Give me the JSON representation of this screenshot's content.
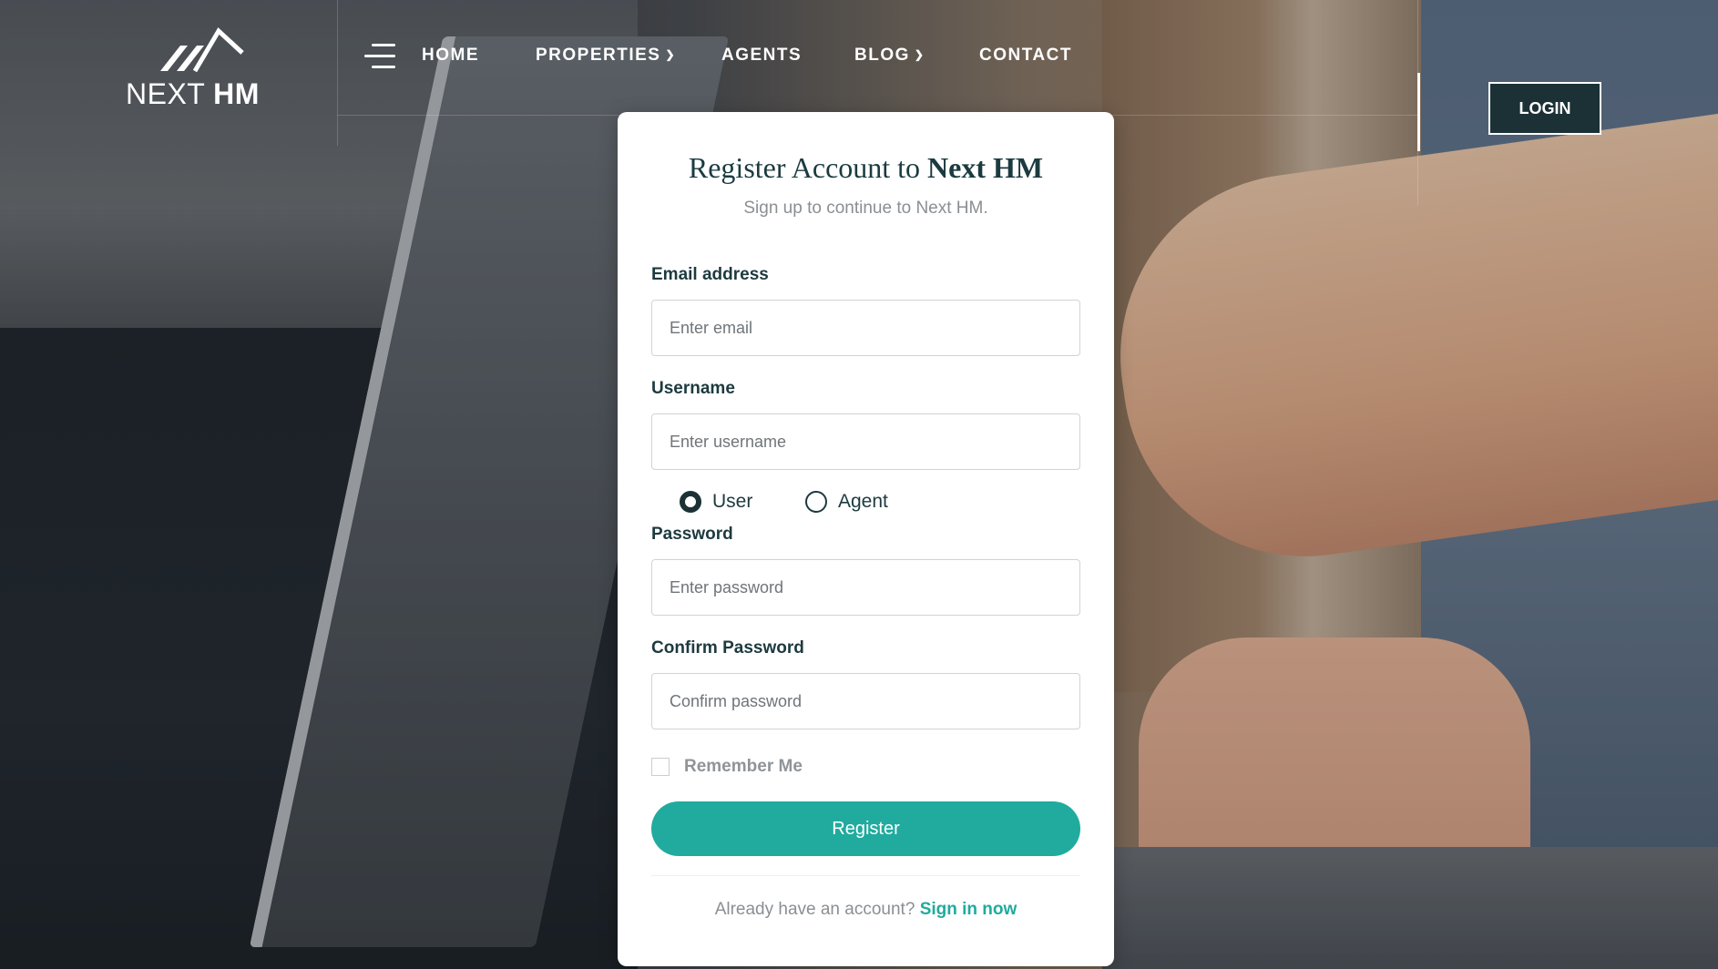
{
  "brand": {
    "logo_text_light": "NEXT",
    "logo_text_bold": "HM"
  },
  "nav": {
    "items": [
      {
        "label": "HOME",
        "has_dropdown": false
      },
      {
        "label": "PROPERTIES",
        "has_dropdown": true
      },
      {
        "label": "AGENTS",
        "has_dropdown": false
      },
      {
        "label": "BLOG",
        "has_dropdown": true
      },
      {
        "label": "CONTACT",
        "has_dropdown": false
      }
    ],
    "login_label": "LOGIN"
  },
  "register": {
    "title_prefix": "Register Account to",
    "title_brand": "Next HM",
    "subtitle": "Sign up to continue to Next HM.",
    "email": {
      "label": "Email address",
      "placeholder": "Enter email",
      "value": ""
    },
    "username": {
      "label": "Username",
      "placeholder": "Enter username",
      "value": ""
    },
    "role_options": [
      {
        "label": "User",
        "checked": true
      },
      {
        "label": "Agent",
        "checked": false
      }
    ],
    "password": {
      "label": "Password",
      "placeholder": "Enter password",
      "value": ""
    },
    "confirm_password": {
      "label": "Confirm Password",
      "placeholder": "Confirm password",
      "value": ""
    },
    "remember_label": "Remember Me",
    "remember_checked": false,
    "submit_label": "Register",
    "signin_prompt": "Already have an account?",
    "signin_link": "Sign in now"
  },
  "colors": {
    "accent": "#20ab9e",
    "dark": "#1b3136",
    "heading": "#1d3a3f"
  }
}
